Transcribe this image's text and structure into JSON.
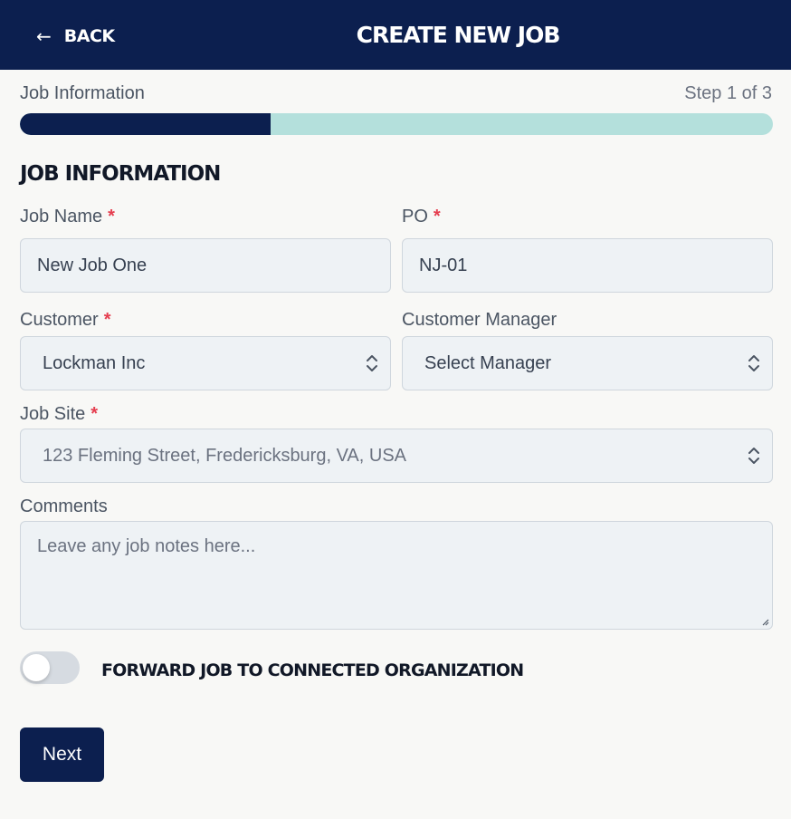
{
  "header": {
    "back_label": "BACK",
    "title": "CREATE NEW JOB"
  },
  "stepper": {
    "label": "Job Information",
    "count": "Step 1 of 3",
    "progress": 0.333,
    "fill_color": "#0c1f4f",
    "track_color": "#b4e0dc"
  },
  "section": {
    "heading": "JOB INFORMATION"
  },
  "form": {
    "job_name": {
      "label": "Job Name",
      "required": "*",
      "value": "New Job One"
    },
    "po": {
      "label": "PO",
      "required": "*",
      "value": "NJ-01"
    },
    "customer": {
      "label": "Customer",
      "required": "*",
      "value": "Lockman Inc"
    },
    "customer_manager": {
      "label": "Customer Manager",
      "value": "Select Manager"
    },
    "job_site": {
      "label": "Job Site",
      "required": "*",
      "value": "123 Fleming Street, Fredericksburg, VA, USA"
    },
    "comments": {
      "label": "Comments",
      "placeholder": "Leave any job notes here..."
    }
  },
  "forward_toggle": {
    "label": "FORWARD JOB TO CONNECTED ORGANIZATION",
    "on": false
  },
  "actions": {
    "next_label": "Next"
  },
  "icons": {
    "back": "arrow-left-icon",
    "select": "chevron-up-down-icon"
  }
}
